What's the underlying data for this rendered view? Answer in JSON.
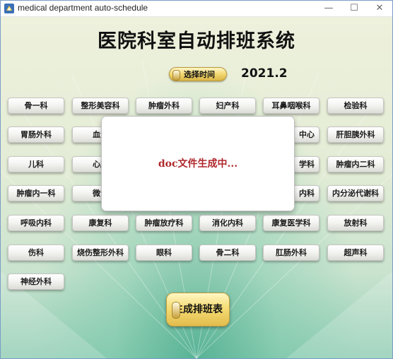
{
  "window": {
    "title": "medical department auto-schedule",
    "controls": {
      "minimize": "—",
      "maximize": "☐",
      "close": "✕"
    }
  },
  "header": {
    "title": "医院科室自动排班系统",
    "select_time_label": "选择时间",
    "year_month": "2021.2"
  },
  "departments": [
    "骨一科",
    "整形美容科",
    "肿瘤外科",
    "妇产科",
    "耳鼻咽喉科",
    "检验科",
    "胃肠外科",
    "血液",
    "中心",
    "肝胆胰外科",
    "儿科",
    "心胸",
    "学科",
    "肿瘤内二科",
    "肿瘤内一科",
    "微创",
    "内科",
    "内分泌代谢科",
    "呼吸内科",
    "康复科",
    "肿瘤放疗科",
    "消化内科",
    "康复医学科",
    "放射科",
    "伤科",
    "烧伤整形外科",
    "眼科",
    "骨二科",
    "肛肠外科",
    "超声科",
    "神经外科"
  ],
  "generate_button_label": "生成排班表",
  "dialog": {
    "message": "doc文件生成中..."
  },
  "colors": {
    "gold_button": "#f2d770",
    "dialog_text": "#b0282d",
    "background_green": "#8fcdb3"
  }
}
